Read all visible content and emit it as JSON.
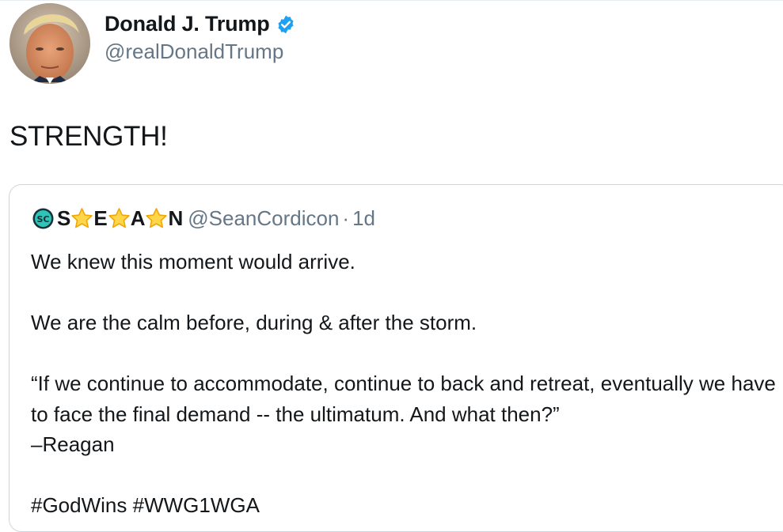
{
  "tweet": {
    "display_name": "Donald J. Trump",
    "handle": "@realDonaldTrump",
    "text": "STRENGTH!",
    "verified_icon": "verified-badge-icon",
    "accent_color": "#1da1f2"
  },
  "quote": {
    "name_letters": [
      "S",
      "E",
      "A",
      "N"
    ],
    "name_icon": "sc-logo-icon",
    "handle": "@SeanCordicon",
    "separator": "·",
    "time": "1d",
    "lines": {
      "line1": "We knew this moment would arrive.",
      "line2": "We are the calm before, during & after the storm.",
      "line3": "“If we continue to accommodate, continue to back and retreat, eventually we have to face the final demand -- the ultimatum. And what then?”",
      "line4": "–Reagan",
      "line5": "#GodWins #WWG1WGA"
    }
  }
}
